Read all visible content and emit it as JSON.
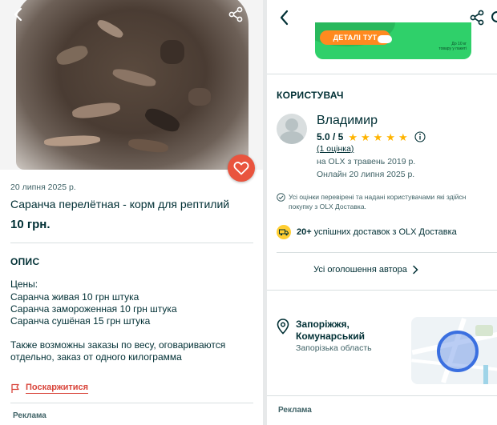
{
  "listing": {
    "date": "20 липня 2025 р.",
    "title": "Саранча перелётная - корм для рептилий",
    "price": "10 грн."
  },
  "description": {
    "section_title": "ОПИС",
    "lines": [
      "Цены:",
      "Саранча живая 10 грн штука",
      "Саранча замороженная 10 грн штука",
      "Саранча сушёная 15 грн штука"
    ],
    "extra_lines": [
      "Также возможны заказы по весу, оговариваются",
      "отдельно, заказ от одного килограмма"
    ]
  },
  "complain": {
    "label": "Поскаржитися"
  },
  "ads": {
    "label_left": "Реклама",
    "label_right": "Реклама"
  },
  "banner": {
    "button_label": "ДЕТАЛІ ТУТ",
    "note_line1": "До 10 кг",
    "note_line2": "товару у пакеті"
  },
  "user": {
    "section_title": "КОРИСТУВАЧ",
    "name": "Владимир",
    "rating": "5.0 / 5",
    "stars": 5,
    "ratings_link": "(1 оцінка)",
    "member_since": "на OLX з травень 2019 р.",
    "online": "Онлайн 20 липня 2025 р.",
    "verified_line1": "Усі оцінки перевірені та надані користувачами які здійсн",
    "verified_line2": "покупку з OLX Доставка.",
    "delivery_count": "20+",
    "delivery_text": " успішних доставок з OLX Доставка",
    "all_ads": "Усі оголошення автора"
  },
  "location": {
    "city_line1": "Запоріжжя,",
    "city_line2": "Комунарський",
    "region": "Запорізька область"
  },
  "colors": {
    "primary_text": "#002f34",
    "secondary_text": "#406367",
    "accent_red": "#e9543e",
    "banner_green": "#2fd06a",
    "banner_orange": "#ff8a1f",
    "star": "#ffb400",
    "map_circle": "#3a6fe0"
  },
  "icons": {
    "back": "chevron-left-icon",
    "share": "share-icon",
    "favorite": "heart-icon",
    "flag": "flag-icon",
    "info": "info-icon",
    "check": "check-circle-icon",
    "truck": "truck-icon",
    "location": "location-pin-icon",
    "chevron_right": "chevron-right-icon"
  }
}
